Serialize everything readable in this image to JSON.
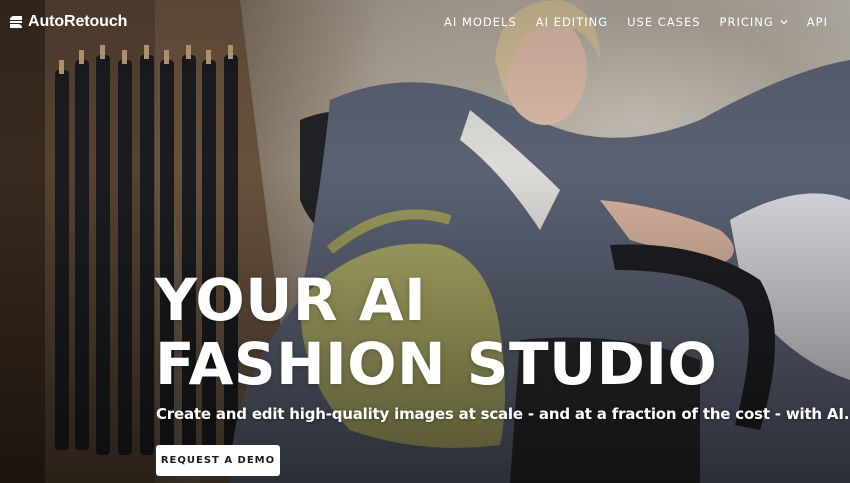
{
  "brand": {
    "name": "AutoRetouch",
    "logo_icon": "autoretouch-logo-icon"
  },
  "nav": {
    "items": [
      {
        "label": "AI MODELS"
      },
      {
        "label": "AI EDITING"
      },
      {
        "label": "USE CASES"
      },
      {
        "label": "PRICING",
        "icon": "chevron-down-icon"
      },
      {
        "label": "API"
      }
    ]
  },
  "hero": {
    "headline_line1": "YOUR AI",
    "headline_line2": "FASHION STUDIO",
    "subheadline": "Create and edit high-quality images at scale - and at a fraction of the cost - with AI.",
    "cta_label": "REQUEST A DEMO"
  },
  "colors": {
    "text": "#ffffff",
    "button_bg": "#ffffff",
    "button_text": "#1b1b1b",
    "bag": "#b3b26a",
    "coat": "#5f6779"
  }
}
